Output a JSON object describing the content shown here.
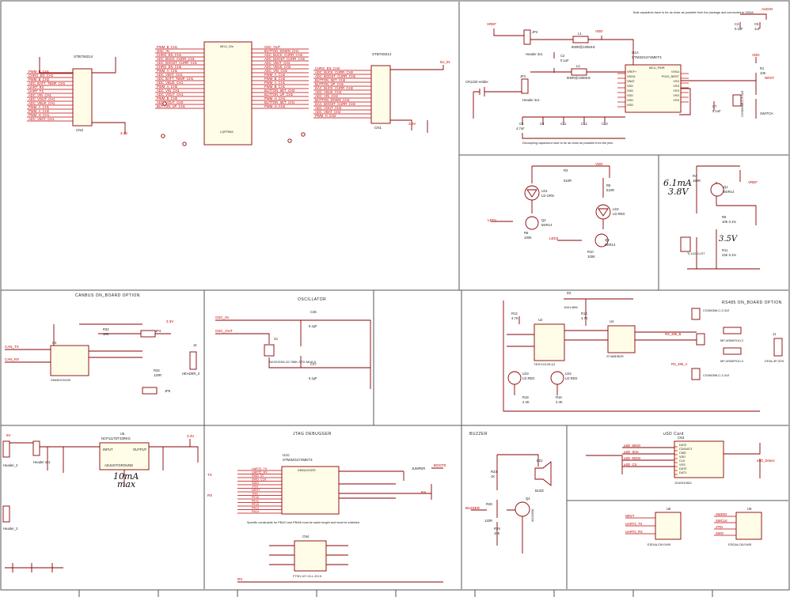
{
  "sheet": {
    "sections": {
      "canbus": "CANBUS ON_BOARD OPTION",
      "oscillator": "OSCILLATOR",
      "jtag": "JTAG DEBUGGER",
      "buzzer": "BUZZER",
      "usd": "uSD Card",
      "rs485": "RS485 ON_BOARD OPTION"
    },
    "mcu_left": {
      "ref": "U1B",
      "part": "STM32G474MET3",
      "sub": "MCU_IOs",
      "footer": "LQFP80A"
    },
    "mcu_power": {
      "ref": "U1A",
      "part": "STM32G474MET3",
      "sub": "MCU_PWR",
      "pins_left": [
        "VREF+",
        "VDDA",
        "VBAT",
        "VDD",
        "VDD",
        "VDD",
        "VDD",
        "VDD"
      ],
      "pins_right": [
        "VSSA",
        "PG10_NRST",
        "VSS",
        "VSS",
        "VSS",
        "VSS",
        "VSS"
      ]
    },
    "mcu_jtag": {
      "ref": "U1C",
      "part": "STM32G474MET3",
      "sub": "DEBUGGER/"
    },
    "conn_left": {
      "ref": "CN2",
      "part": "STB7S8214"
    },
    "conn_right": {
      "ref": "CN1",
      "part": "STB7S8214"
    },
    "notes": {
      "bulk_caps": "Bulk capacitors have to be as close as possible from the package and connected to VDDA",
      "decoupling": "Decoupling capacitors have to be as close as possible from the pins",
      "jtag_note": "Specific constraints for PB4/0 and PB4/8 must be same length and must be shielded"
    },
    "labels": {
      "vref": "VREF",
      "vdd": "VDD",
      "audio": "AUDIO",
      "v33": "3.3V",
      "v5": "5V",
      "v5in": "5V_IN",
      "header_3x1": "Header 3x1",
      "header_2": "Header_2",
      "header_3": "HEADER_3",
      "cr_holder": "CR1220 Holder",
      "switch": "SWITCH",
      "jumper": "JUMPER",
      "boot": "BOOT0",
      "nrst": "NRST",
      "rx": "RX",
      "tx": "TX",
      "gnd": "GND"
    },
    "osc": {
      "ref": "X1",
      "part": "NX3215SA-32.768K-STD-MUA-9",
      "c1": "C36",
      "c2": "C37",
      "cval": "5.1pF",
      "in": "OSC_IN",
      "out": "OSC_OUT"
    },
    "can": {
      "ref": "U3",
      "part": "SN65HVD230",
      "rt": "R32",
      "rval": "10K",
      "can_tx": "CAN_TX",
      "can_rx": "CAN_RX",
      "jp": "JP4",
      "jp2": "JP5",
      "j": "J4",
      "res": "R34",
      "resv": "120R"
    },
    "ldo": {
      "ref": "U5",
      "part": "NCP1117DT33RKG",
      "input": "INPUT",
      "output": "OUTPUT",
      "adj": "ADJUST/GROUND",
      "note": "10mA\nmax"
    },
    "buzzer": {
      "ref": "BZ1",
      "part": "BUZZ",
      "q": "Q4",
      "qpart": "AO3400A",
      "r1": "R23",
      "r1v": "1K",
      "r2": "R28",
      "r2v": "120R",
      "r3": "R29",
      "r3v": "10K",
      "net": "BUZZER"
    },
    "usd": {
      "ref": "CN3",
      "part": "1040310811",
      "pins": [
        "DAT2",
        "CD/DAT3",
        "CMD",
        "VDD",
        "CLK",
        "VSS",
        "DAT0",
        "DAT1"
      ],
      "sd_miso": "uSD_MISO",
      "sd_sck": "uSD_SCK",
      "sd_mosi": "uSD_MOSI",
      "sd_cs": "uSD_CS",
      "detect": "uSD_Detect"
    },
    "esd": {
      "ref1": "U6",
      "ref2": "U9",
      "part": "ESDALC6V1W5",
      "nets_a": [
        "NRST",
        "UART2_TX",
        "UART2_RX"
      ],
      "nets_b": [
        "SWDIO",
        "SWCLK",
        "JTDI",
        "SWO"
      ]
    },
    "rs485": {
      "ref": "U4",
      "part": "ST485EBDR",
      "pins": [
        "RO",
        "VCC",
        "RE",
        "B",
        "DE",
        "A",
        "DI",
        "GND"
      ],
      "fuse": "MF-MSMF010-2",
      "tvs": "CG0603MLC-3.3LE",
      "j": "J1",
      "jpart": "DF3A-3P-2DS",
      "bus_a": "RS_485_A",
      "bus_b": "RS_485_B"
    },
    "leds": {
      "ld1": "LD1",
      "ld1c": "LD GRN",
      "ld2": "LD2",
      "ld2c": "LD RED",
      "q2": "Q2",
      "q3": "Q3",
      "q": "BSR14",
      "r3": "R3",
      "r3v": "510R",
      "r5": "R5",
      "r5v": "510R",
      "r8": "R8",
      "r8v": "100K",
      "r10": "R10",
      "r10v": "100K",
      "led1": "LED1",
      "led2": "LED2"
    },
    "vref_ckt": {
      "ref": "U8",
      "part": "TL1431CLST",
      "r4": "R4",
      "r4v": "180R",
      "q1": "Q1",
      "q1p": "BSR14",
      "r6": "R6",
      "r6v": "10K 0.1%",
      "r11": "R11",
      "r11v": "23K 0.1%",
      "annot1": "6.1mA",
      "annot2": "3.8V",
      "annot3": "3.5V"
    },
    "translator": {
      "ref": "U2",
      "part": "74HC1G126-Q1",
      "d1": "D2",
      "d1p": "1N4148W",
      "r12": "R12",
      "r12v": "4.7K",
      "r14": "R14",
      "r14v": "4.7K",
      "ld3": "LD3",
      "ld4": "LD4",
      "ldc": "LD RED",
      "r18": "R18",
      "r18v": "2.4K",
      "r16": "R16",
      "r16v": "2.4K"
    },
    "debugger": {
      "cn": "CN4",
      "cnpart": "FTSH-107-01-L-DV-K",
      "pins_left": [
        "UART2_TX",
        "UART2_RX",
        "SWD_IO",
        "SWD_CLK",
        "SWO",
        "JTDI",
        "NRST",
        "TDO",
        "PE10",
        "PE11",
        "PE12",
        "PA13",
        "PA14"
      ]
    },
    "filters": {
      "l1": "L1",
      "l1v": "600R@100MHz",
      "l2": "L2",
      "l2v": "600R@100MHz",
      "jp2": "JP2",
      "jp1": "JP1"
    },
    "caps": {
      "c4": "C4",
      "c4v": "0.1uF",
      "c5": "C5",
      "c5v": "1uF",
      "c6": "C6",
      "c6v": "1uF",
      "c2": "C2",
      "c2v": "0.1uF",
      "c7": "C7",
      "c7v": "0.1uF",
      "c8": "C8",
      "c8v": "4.7uF",
      "c9": "C9",
      "c11": "C11",
      "c12": "C12",
      "c13": "C13",
      "cval": "0.1uF"
    },
    "nrst_ckt": {
      "r1": "R1",
      "r1v": "10K",
      "d1": "D1",
      "d1p": "CG0603MLC-3.3LE",
      "sw": "SWITCH"
    },
    "mcu_left_nets": [
      "PWM_B_CH1",
      "OSC_IN",
      "CHRG_EN_CH1",
      "ADC_BUCK_CURR_CH1",
      "ADC_BOOST_CURR_CH1",
      "CHRG_EN_CH2",
      "PWM_A_CH1",
      "ADC_VBAT_CH1",
      "ADC_BATT_TEMP_CH1",
      "ADC_VBUS_CH1",
      "PWM_A_CH2",
      "ADC_VIN_CH1",
      "ADC_VOUT_CH1",
      "PWM_B_CH2",
      "ADC_VOUT_CH2",
      "BUTTON_UP_CH1"
    ],
    "mcu_right_nets": [
      "OSC_OUT",
      "BUTTON_DOWN_CH1",
      "ADC_BUCK_CURR_CH2",
      "ADC_BOOST_CURR_CH2",
      "ADC_VBAT_CH2",
      "ADC_VBUS_CH2",
      "ADC_VIN_CH2",
      "PWM_A_CH2",
      "PWM_B_CH2",
      "PWM_A_CH1",
      "PWM_B_CH1",
      "BUTTON_SET_CH2",
      "BUTTON_UP_CH2",
      "PWM_H_CH1",
      "BUTTON_SET_CH1",
      "PWM_H_CH2"
    ],
    "cn2_nets": [
      "PWM_B_CH1",
      "CHRG_EN_CH1",
      "PWM_B_CH2",
      "ADC_BATT_TEMP_CH1",
      "UART_RX",
      "UART_TX",
      "ADC_VIN_CH1",
      "ADC_VOUT_CH1",
      "ADC_VBUS_CH1",
      "PWM_A_CH1",
      "PWM_A_CH2",
      "PWM_H_CH1",
      "ADC_VBAT_CH1"
    ],
    "cn1_nets": [
      "CHRG_EN_CH2",
      "ADC_BUCK_CURR_CH2",
      "ADC_BOOST_CURR_CH2",
      "BUTTON_SET_CH2",
      "BUTTON_UP_CH2",
      "DAC_BUCK_CURR_CH2",
      "ADC_VBUS_CH2",
      "ADC_VIN_CH2",
      "BUTTON_DOWN_CH2",
      "DAC_BOOST_CURR_CH2",
      "ADC_VOUT_CH2",
      "ADC_VBAT_CH2",
      "PWM_H_CH2"
    ]
  }
}
